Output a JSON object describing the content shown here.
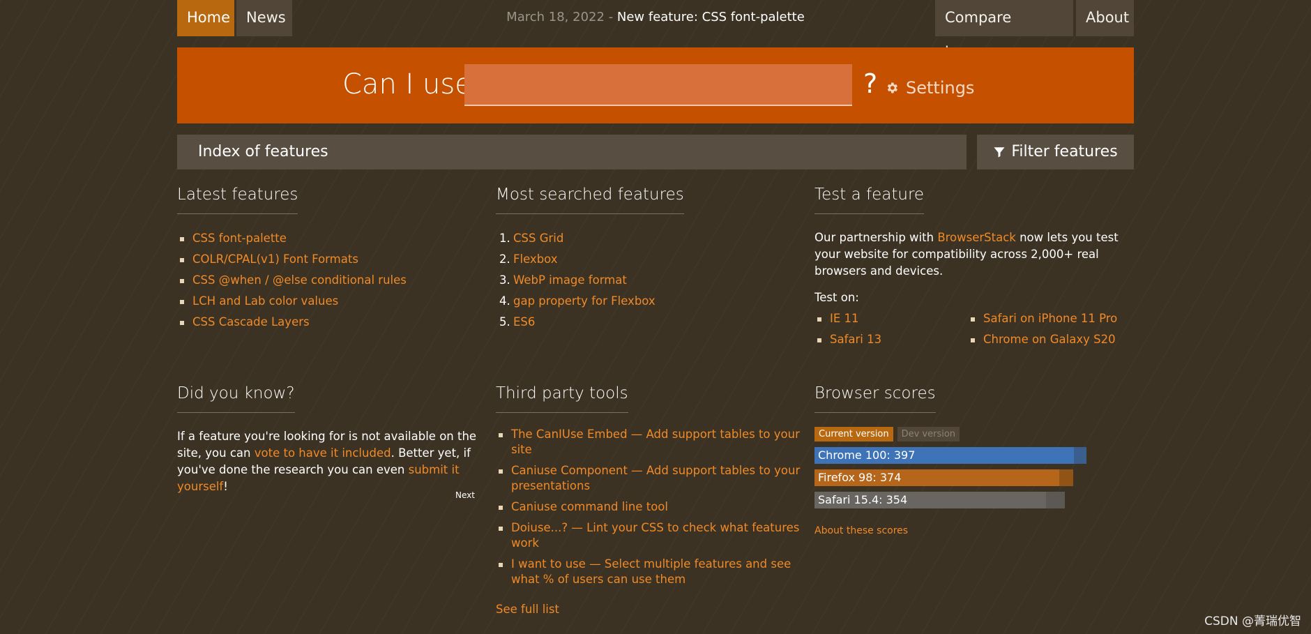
{
  "nav": {
    "home": "Home",
    "news": "News",
    "news_date": "March 18, 2022",
    "news_sep": " - ",
    "news_text": "New feature: CSS font-palette",
    "compare": "Compare browsers",
    "about": "About"
  },
  "search": {
    "label": "Can I use",
    "value": "",
    "qmark": "?",
    "settings": "Settings"
  },
  "index": {
    "title": "Index of features",
    "filter": "Filter features"
  },
  "latest": {
    "title": "Latest features",
    "items": [
      "CSS font-palette",
      "COLR/CPAL(v1) Font Formats",
      "CSS @when / @else conditional rules",
      "LCH and Lab color values",
      "CSS Cascade Layers"
    ]
  },
  "most_searched": {
    "title": "Most searched features",
    "items": [
      {
        "n": "1.",
        "label": "CSS Grid"
      },
      {
        "n": "2.",
        "label": "Flexbox"
      },
      {
        "n": "3.",
        "label": "WebP image format"
      },
      {
        "n": "4.",
        "label": "gap property for Flexbox"
      },
      {
        "n": "5.",
        "label": "ES6"
      }
    ]
  },
  "test": {
    "title": "Test a feature",
    "text_before": "Our partnership with ",
    "link": "BrowserStack",
    "text_after": " now lets you test your website for compatibility across 2,000+ real browsers and devices.",
    "test_on": "Test on:",
    "browsers_left": [
      "IE 11",
      "Safari 13"
    ],
    "browsers_right": [
      "Safari on iPhone 11 Pro",
      "Chrome on Galaxy S20"
    ]
  },
  "did_you_know": {
    "title": "Did you know?",
    "t1": "If a feature you're looking for is not available on the site, you can ",
    "link1": "vote to have it included",
    "t2": ". Better yet, if you've done the research you can even ",
    "link2": "submit it yourself",
    "t3": "!",
    "next": "Next"
  },
  "tools": {
    "title": "Third party tools",
    "items": [
      "The CanIUse Embed — Add support tables to your site",
      "Caniuse Component — Add support tables to your presentations",
      "Caniuse command line tool",
      "Doiuse...? — Lint your CSS to check what features work",
      "I want to use — Select multiple features and see what % of users can use them"
    ],
    "see_full": "See full list"
  },
  "scores": {
    "title": "Browser scores",
    "tab_current": "Current version",
    "tab_dev": "Dev version",
    "rows": [
      {
        "label": "Chrome 100: 397",
        "value": 397,
        "max": 416,
        "color": "#3e74b7",
        "track": "#3a5f8e"
      },
      {
        "label": "Firefox 98: 374",
        "value": 374,
        "max": 396,
        "color": "#b5661a",
        "track": "#8f5416"
      },
      {
        "label": "Safari 15.4: 354",
        "value": 354,
        "max": 383,
        "color": "#696561",
        "track": "#5c5854"
      }
    ],
    "about": "About these scores"
  },
  "watermark": "CSDN @菁瑞优智"
}
